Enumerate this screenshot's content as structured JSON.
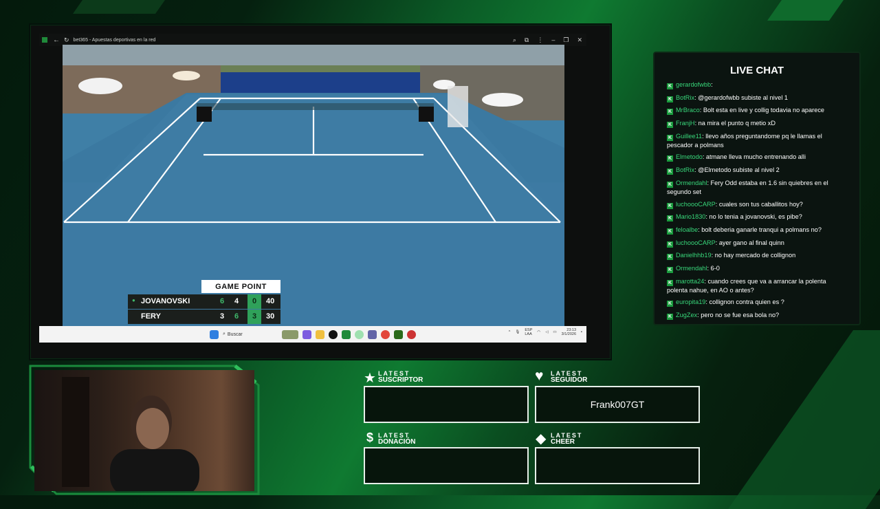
{
  "browser": {
    "title": "bet365 - Apuestas deportivas en la red",
    "controls": [
      "zoom-icon",
      "extensions-icon",
      "more-icon",
      "minimize-icon",
      "restore-icon",
      "close-icon"
    ]
  },
  "scoreboard": {
    "banner": "GAME POINT",
    "players": [
      {
        "name": "JOVANOVSKI",
        "serving": true,
        "set1": "6",
        "set2": "4",
        "set3": "0",
        "points": "40"
      },
      {
        "name": "FERY",
        "serving": false,
        "set1": "3",
        "set2": "6",
        "set3": "3",
        "points": "30"
      }
    ]
  },
  "taskbar": {
    "search_placeholder": "Buscar",
    "lang": "ESP",
    "lang2": "LAA",
    "time": "23:13",
    "date": "3/1/2026"
  },
  "chat": {
    "title": "LIVE CHAT",
    "messages": [
      {
        "user": "gerardofwbb",
        "text": ":"
      },
      {
        "user": "BotRix",
        "text": ": @gerardofwbb subiste al nivel 1"
      },
      {
        "user": "MrBraco",
        "text": ": Bolt esta en live y collig todavia no aparece"
      },
      {
        "user": "FranjH",
        "text": ": na mira el punto q metio xD"
      },
      {
        "user": "Guillee11",
        "text": ": llevo años preguntandome pq le llamas el pescador a polmans"
      },
      {
        "user": "Elmetodo",
        "text": ": atmane lleva mucho entrenando alli"
      },
      {
        "user": "BotRix",
        "text": ": @Elmetodo subiste al nivel 2"
      },
      {
        "user": "Ormendahl",
        "text": ": Fery Odd estaba en 1.6 sin quiebres en el segundo set"
      },
      {
        "user": "luchoooCARP",
        "text": ": cuales son tus caballitos hoy?"
      },
      {
        "user": "Mario1830",
        "text": ": no lo tenia a jovanovski, es pibe?"
      },
      {
        "user": "feloalbe",
        "text": ": bolt deberia ganarle tranqui a polmans no?"
      },
      {
        "user": "luchoooCARP",
        "text": ": ayer gano al final quinn"
      },
      {
        "user": "Danielhhb19",
        "text": ": no hay mercado de collignon"
      },
      {
        "user": "Ormendahl",
        "text": ": 6-0"
      },
      {
        "user": "marotta24",
        "text": ": cuando crees que va a arrancar la polenta polenta nahue, en AO o antes?"
      },
      {
        "user": "europita19",
        "text": ": collignon contra quien es ?"
      },
      {
        "user": "ZugZex",
        "text": ": pero no se fue esa bola no?"
      }
    ]
  },
  "widgets": {
    "suscriptor": {
      "line1": "LATEST",
      "line2": "SUSCRIPTOR",
      "value": ""
    },
    "seguidor": {
      "line1": "LATEST",
      "line2": "SEGUIDOR",
      "value": "Frank007GT"
    },
    "donacion": {
      "line1": "LATEST",
      "line2": "DONACIÓN",
      "value": ""
    },
    "cheer": {
      "line1": "LATEST",
      "line2": "CHEER",
      "value": ""
    }
  },
  "colors": {
    "accent": "#2fa15a",
    "chat_user": "#38d77a",
    "court": "#3f7fa6"
  }
}
